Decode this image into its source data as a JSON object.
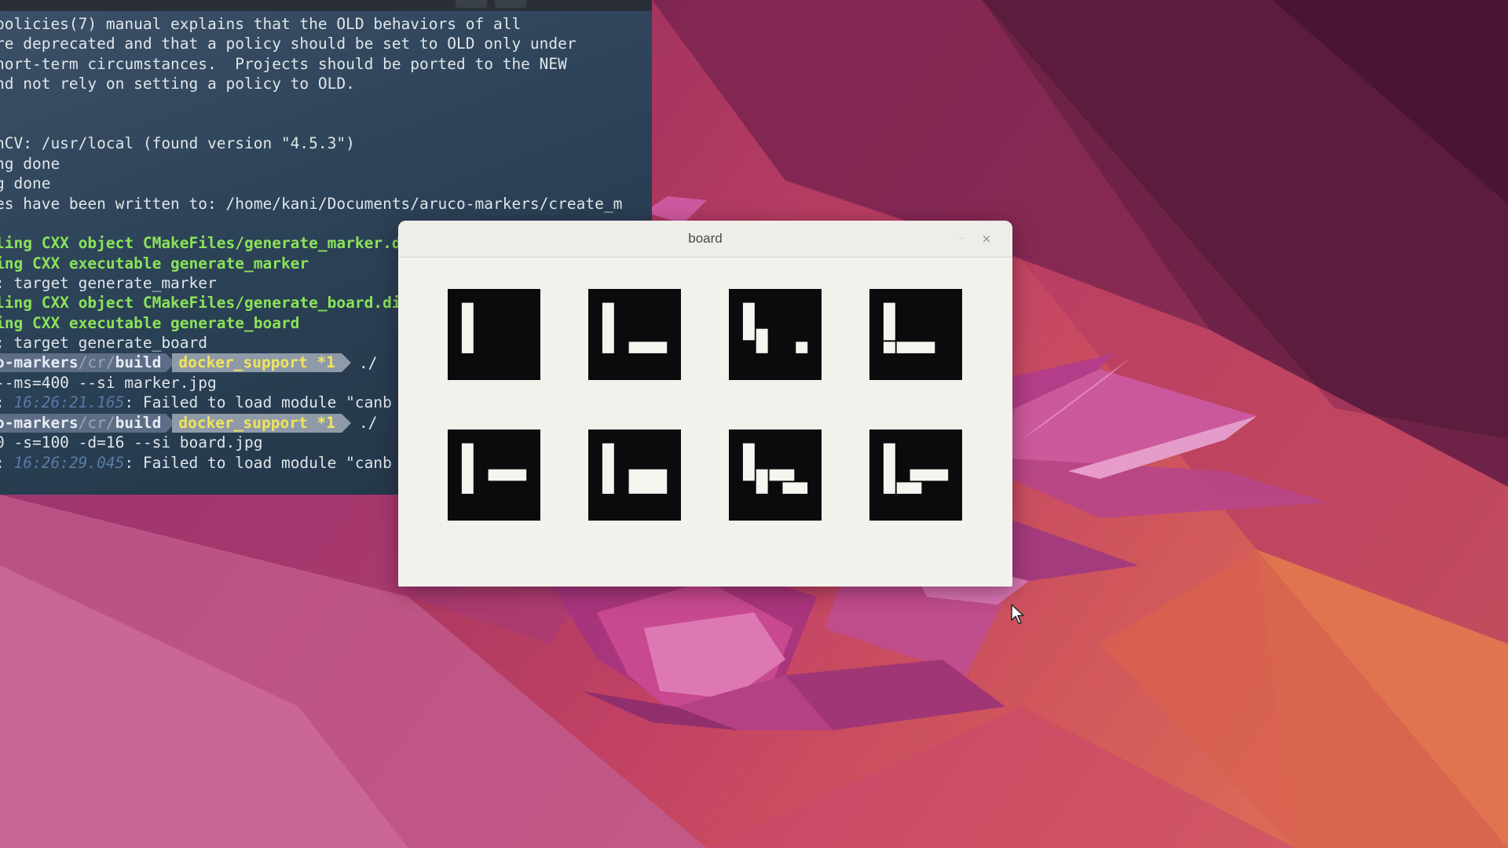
{
  "terminal": {
    "lines": [
      {
        "parts": [
          {
            "text": "policies(7) manual explains that the OLD behaviors of all",
            "style": "normal"
          }
        ]
      },
      {
        "parts": [
          {
            "text": "re deprecated and that a policy should be set to OLD only under",
            "style": "normal"
          }
        ]
      },
      {
        "parts": [
          {
            "text": "hort-term circumstances.  Projects should be ported to the NEW",
            "style": "normal"
          }
        ]
      },
      {
        "parts": [
          {
            "text": "nd not rely on setting a policy to OLD.",
            "style": "normal"
          }
        ]
      },
      {
        "parts": [
          {
            "text": "",
            "style": "normal"
          }
        ]
      },
      {
        "parts": [
          {
            "text": "",
            "style": "normal"
          }
        ]
      },
      {
        "parts": [
          {
            "text": "nCV: /usr/local (found version \"4.5.3\")",
            "style": "normal"
          }
        ]
      },
      {
        "parts": [
          {
            "text": "ng done",
            "style": "normal"
          }
        ]
      },
      {
        "parts": [
          {
            "text": "g done",
            "style": "normal"
          }
        ]
      },
      {
        "parts": [
          {
            "text": "es have been written to: /home/kani/Documents/aruco-markers/create_m",
            "style": "normal"
          }
        ]
      },
      {
        "parts": [
          {
            "text": "",
            "style": "normal"
          }
        ]
      },
      {
        "parts": [
          {
            "text": "ling CXX object CMakeFiles/generate_marker.dir",
            "style": "green"
          }
        ]
      },
      {
        "parts": [
          {
            "text": "ing CXX executable generate_marker",
            "style": "green"
          }
        ]
      },
      {
        "parts": [
          {
            "text": ": target generate_marker",
            "style": "normal"
          }
        ]
      },
      {
        "parts": [
          {
            "text": "ling CXX object CMakeFiles/generate_board.dir",
            "style": "green"
          }
        ]
      },
      {
        "parts": [
          {
            "text": "ing CXX executable generate_board",
            "style": "green"
          }
        ]
      },
      {
        "parts": [
          {
            "text": ": target generate_board",
            "style": "normal"
          }
        ]
      },
      {
        "prompt": true,
        "dir": "o-markers",
        "dim": "/cr/",
        "dir2": "build",
        "git": "docker_support *1",
        "tail": "./"
      },
      {
        "parts": [
          {
            "text": "--ms=400 --si marker.jpg",
            "style": "normal"
          }
        ]
      },
      {
        "parts": [
          {
            "text": ": ",
            "style": "normal"
          },
          {
            "text": "16:26:21.165",
            "style": "dim"
          },
          {
            "text": ": Failed to load module \"canb",
            "style": "normal"
          }
        ]
      },
      {
        "prompt": true,
        "dir": "o-markers",
        "dim": "/cr/",
        "dir2": "build",
        "git": "docker_support *1",
        "tail": "./"
      },
      {
        "parts": [
          {
            "text": "0 -s=100 -d=16 --si board.jpg",
            "style": "normal"
          }
        ]
      },
      {
        "parts": [
          {
            "text": ": ",
            "style": "normal"
          },
          {
            "text": "16:26:29.045",
            "style": "dim"
          },
          {
            "text": ": Failed to load module \"canb",
            "style": "normal"
          }
        ]
      }
    ]
  },
  "board_window": {
    "title": "board",
    "close_glyph": "×",
    "minimize_glyph": "–",
    "markers": [
      {
        "id": 0,
        "rects": [
          [
            1,
            1,
            1,
            4
          ]
        ]
      },
      {
        "id": 1,
        "rects": [
          [
            1,
            1,
            1,
            4
          ],
          [
            3,
            4,
            3,
            1
          ]
        ]
      },
      {
        "id": 2,
        "rects": [
          [
            1,
            1,
            1,
            3
          ],
          [
            2,
            3,
            1,
            2
          ],
          [
            5,
            4,
            1,
            1
          ]
        ]
      },
      {
        "id": 3,
        "rects": [
          [
            1,
            1,
            1,
            3
          ],
          [
            1,
            4,
            1,
            1
          ],
          [
            2,
            4,
            3,
            1
          ]
        ]
      },
      {
        "id": 4,
        "rects": [
          [
            1,
            1,
            1,
            4
          ],
          [
            3,
            3,
            3,
            1
          ]
        ]
      },
      {
        "id": 5,
        "rects": [
          [
            1,
            1,
            1,
            4
          ],
          [
            3,
            3,
            3,
            2
          ]
        ]
      },
      {
        "id": 6,
        "rects": [
          [
            1,
            1,
            1,
            3
          ],
          [
            2,
            3,
            1,
            2
          ],
          [
            3,
            3,
            2,
            1
          ],
          [
            4,
            4,
            2,
            1
          ]
        ]
      },
      {
        "id": 7,
        "rects": [
          [
            1,
            1,
            1,
            4
          ],
          [
            2,
            4,
            2,
            1
          ],
          [
            3,
            3,
            3,
            1
          ]
        ]
      }
    ]
  },
  "colors": {
    "marker_black": "#0c0a0c",
    "marker_white": "#f5f4ef",
    "terminal_green": "#8be35a"
  }
}
